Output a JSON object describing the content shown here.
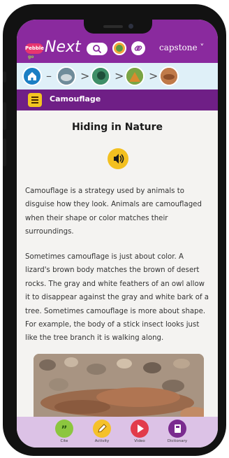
{
  "header": {
    "logo_badge": "Pebble",
    "logo_sub": "go",
    "logo_text": "Next",
    "publisher": "capstone ˅"
  },
  "section": {
    "title": "Camouflage"
  },
  "article": {
    "heading": "Hiding in Nature",
    "paragraph1": "Camouflage is a strategy used by animals to disguise how they look. Animals are camouflaged when their shape or color matches their surroundings.",
    "paragraph2": "Sometimes camouflage is just about color. A lizard's brown body matches the brown of desert rocks. The gray and white feathers of an owl allow it to disappear against the gray and white bark of a tree. Sometimes camouflage is more about shape. For example, the body of a stick insect looks just like the tree branch it is walking along."
  },
  "bottom_nav": [
    {
      "label": "Cite",
      "icon": "quote-icon",
      "color": "#8cc63f"
    },
    {
      "label": "Activity",
      "icon": "pencil-icon",
      "color": "#f5c12a"
    },
    {
      "label": "Video",
      "icon": "play-icon",
      "color": "#e23b4b"
    },
    {
      "label": "Dictionary",
      "icon": "book-icon",
      "color": "#7a2a8f"
    }
  ],
  "colors": {
    "header": "#8a2a9e",
    "titlebar": "#6f1f86",
    "breadcrumb_bg": "#dff0f8",
    "accent": "#f3c020"
  }
}
